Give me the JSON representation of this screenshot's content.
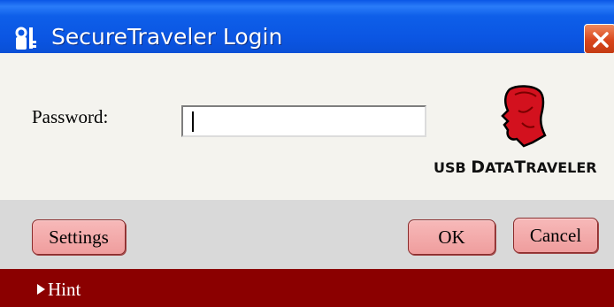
{
  "window": {
    "title": "SecureTraveler Login",
    "title_icon": "key-lock-icon",
    "close_icon": "close-icon"
  },
  "form": {
    "password_label": "Password:",
    "password_value": ""
  },
  "logo": {
    "icon": "kingston-head-logo-icon",
    "text_usb": "USB ",
    "text_d": "D",
    "text_ata": "ATA",
    "text_t": "T",
    "text_raveler": "RAVELER"
  },
  "buttons": {
    "settings_label": "Settings",
    "ok_label": "OK",
    "cancel_label": "Cancel"
  },
  "hint": {
    "label": "Hint",
    "icon": "triangle-right-icon"
  },
  "colors": {
    "titlebar": "#0b56e3",
    "body_bg": "#f4f3ee",
    "button_area_bg": "#d9d9d9",
    "button_fill": "#f2a8a8",
    "hint_bar": "#8b0000",
    "close_button": "#d9461c",
    "logo_red": "#d3111e"
  }
}
